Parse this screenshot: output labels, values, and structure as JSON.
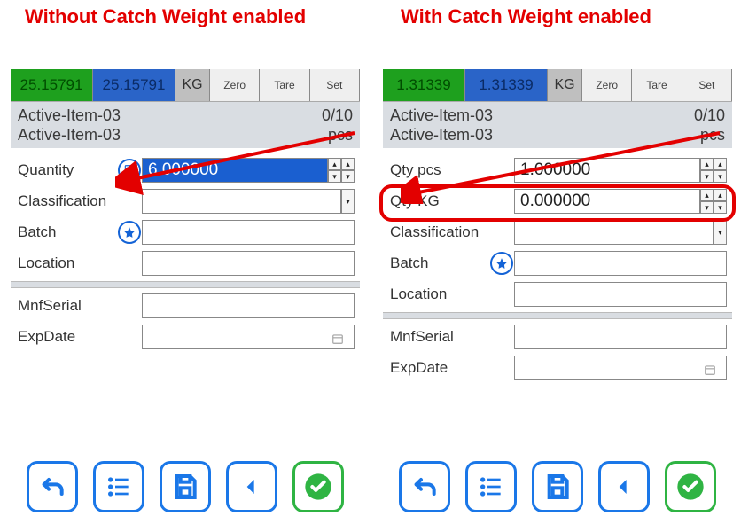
{
  "captions": {
    "left": "Without Catch Weight enabled",
    "right": "With Catch Weight enabled"
  },
  "left": {
    "weight": {
      "gross": "25.15791",
      "net": "25.15791",
      "unit": "KG",
      "btn_zero": "Zero",
      "btn_tare": "Tare",
      "btn_set": "Set"
    },
    "item": {
      "line1": "Active-Item-03",
      "count": "0/10",
      "line2": "Active-Item-03",
      "uom": "pcs"
    },
    "labels": {
      "quantity": "Quantity",
      "classification": "Classification",
      "batch": "Batch",
      "location": "Location",
      "mnfserial": "MnfSerial",
      "expdate": "ExpDate"
    },
    "values": {
      "quantity": "6.000000",
      "classification": "",
      "batch": "",
      "location": "",
      "mnfserial": "",
      "expdate": ""
    }
  },
  "right": {
    "weight": {
      "gross": "1.31339",
      "net": "1.31339",
      "unit": "KG",
      "btn_zero": "Zero",
      "btn_tare": "Tare",
      "btn_set": "Set"
    },
    "item": {
      "line1": "Active-Item-03",
      "count": "0/10",
      "line2": "Active-Item-03",
      "uom": "pcs"
    },
    "labels": {
      "qty_pcs": "Qty pcs",
      "qty_kg": "Qty KG",
      "classification": "Classification",
      "batch": "Batch",
      "location": "Location",
      "mnfserial": "MnfSerial",
      "expdate": "ExpDate"
    },
    "values": {
      "qty_pcs": "1.000000",
      "qty_kg": "0.000000",
      "classification": "",
      "batch": "",
      "location": "",
      "mnfserial": "",
      "expdate": ""
    }
  }
}
